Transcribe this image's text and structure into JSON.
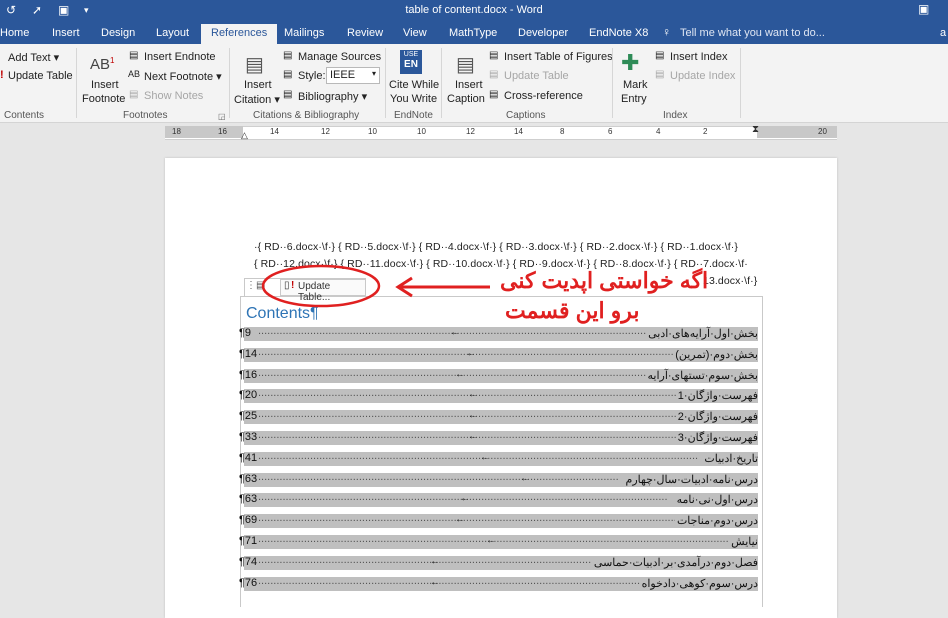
{
  "window": {
    "title": "table of content.docx - Word",
    "minimize": "—"
  },
  "tabs": [
    {
      "label": "Home"
    },
    {
      "label": "Insert"
    },
    {
      "label": "Design"
    },
    {
      "label": "Layout"
    },
    {
      "label": "References"
    },
    {
      "label": "Mailings"
    },
    {
      "label": "Review"
    },
    {
      "label": "View"
    },
    {
      "label": "MathType"
    },
    {
      "label": "Developer"
    },
    {
      "label": "EndNote X8"
    }
  ],
  "tell_me": "Tell me what you want to do...",
  "ribbon": {
    "toc": {
      "add_text": "Add Text",
      "update_table": "Update Table",
      "group": "Contents"
    },
    "footnotes": {
      "insert_footnote_1": "Insert",
      "insert_footnote_2": "Footnote",
      "insert_endnote": "Insert Endnote",
      "next_footnote": "Next Footnote",
      "show_notes": "Show Notes",
      "group": "Footnotes"
    },
    "citations": {
      "insert_citation_1": "Insert",
      "insert_citation_2": "Citation",
      "manage_sources": "Manage Sources",
      "style_label": "Style:",
      "style_value": "IEEE",
      "bibliography": "Bibliography",
      "group": "Citations & Bibliography"
    },
    "endnote": {
      "cite_1": "Cite While",
      "cite_2": "You Write",
      "group": "EndNote",
      "logo_1": "USE",
      "logo_2": "EN"
    },
    "captions": {
      "insert_caption_1": "Insert",
      "insert_caption_2": "Caption",
      "insert_tof": "Insert Table of Figures",
      "update_table": "Update Table",
      "cross_ref": "Cross-reference",
      "group": "Captions"
    },
    "index": {
      "mark_1": "Mark",
      "mark_2": "Entry",
      "insert_index": "Insert Index",
      "update_index": "Update Index",
      "group": "Index"
    }
  },
  "ruler": {
    "ticks": [
      "18",
      "16",
      "14",
      "12",
      "10",
      "8",
      "6",
      "4",
      "2",
      "2",
      "20"
    ]
  },
  "document": {
    "rd_line_1": "·{ RD··6.docx·\\f·} { RD··5.docx·\\f·} { RD··4.docx·\\f·} { RD··3.docx·\\f·} { RD··2.docx·\\f·} { RD··1.docx·\\f·}",
    "rd_line_2": "{ RD··12.docx·\\f·} { RD··11.docx·\\f·} { RD··10.docx·\\f·} { RD··9.docx·\\f·} { RD··8.docx·\\f·} { RD··7.docx·\\f·",
    "rd_line_3": "13.docx·\\f·}",
    "update_table_button": "Update Table...",
    "contents_title": "Contents¶",
    "toc": [
      {
        "title": "بخش·اول·آرایه‌های·ادبی",
        "page": "¶9"
      },
      {
        "title": "بخش·دوم·(تمرین)",
        "page": "¶14"
      },
      {
        "title": "بخش·سوم·تستهای·آرایه",
        "page": "¶16"
      },
      {
        "title": "فهرست·واژگان·1",
        "page": "¶20"
      },
      {
        "title": "فهرست·واژگان·2",
        "page": "¶25"
      },
      {
        "title": "فهرست·واژگان·3",
        "page": "¶33"
      },
      {
        "title": "تاریخ·ادبیات",
        "page": "¶41"
      },
      {
        "title": "درس·نامه·ادبیات·سال·چهارم",
        "page": "¶63"
      },
      {
        "title": "درس·اول·نی·نامه",
        "page": "¶63"
      },
      {
        "title": "درس·دوم·مناجات",
        "page": "¶69"
      },
      {
        "title": "نیایش",
        "page": "¶71"
      },
      {
        "title": "فصل·دوم·درآمدی·بر·ادبیات·حماسی",
        "page": "¶74"
      },
      {
        "title": "درس·سوم·کوهی·دادخواه",
        "page": "¶76"
      }
    ]
  },
  "annotation": {
    "line_1": "اگه خواستی اپدیت کنی",
    "line_2": "برو این قسمت",
    "color": "#e02020"
  }
}
